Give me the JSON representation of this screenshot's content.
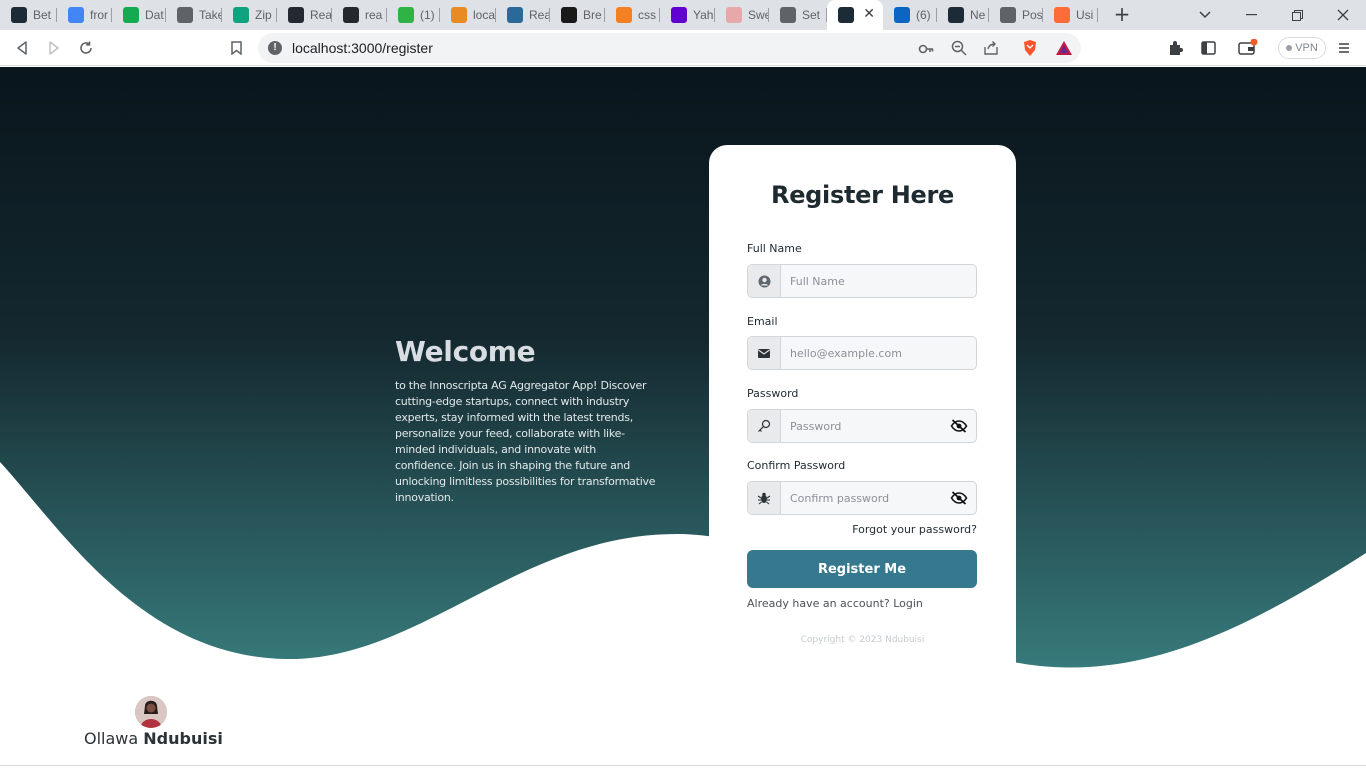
{
  "browser": {
    "tabs": [
      {
        "label": "Bet",
        "icon": "react-icon",
        "color": "#1c2b36"
      },
      {
        "label": "fror",
        "icon": "google-icon",
        "color": "#4285f4"
      },
      {
        "label": "Dat",
        "icon": "mongodb-icon",
        "color": "#13aa52"
      },
      {
        "label": "Take",
        "icon": "globe-icon",
        "color": "#5f6368"
      },
      {
        "label": "Zip",
        "icon": "openai-icon",
        "color": "#10a37f"
      },
      {
        "label": "Rea",
        "icon": "github-icon",
        "color": "#24292f"
      },
      {
        "label": "rea",
        "icon": "github-icon",
        "color": "#24292f"
      },
      {
        "label": "(1) ",
        "icon": "one-icon",
        "color": "#2fb344"
      },
      {
        "label": "loca",
        "icon": "pwa-icon",
        "color": "#e88b24"
      },
      {
        "label": "Rea",
        "icon": "rtk-icon",
        "color": "#2a6a9a"
      },
      {
        "label": "Bre",
        "icon": "st-icon",
        "color": "#1a1a1a"
      },
      {
        "label": "css",
        "icon": "stackoverflow-icon",
        "color": "#f48024"
      },
      {
        "label": "Yah",
        "icon": "yahoo-icon",
        "color": "#6001d2"
      },
      {
        "label": "Swe",
        "icon": "sweet-icon",
        "color": "#e6a8a8"
      },
      {
        "label": "Set",
        "icon": "gear-icon",
        "color": "#5f6368"
      },
      {
        "label": "",
        "icon": "react-icon",
        "color": "#1c2b36"
      },
      {
        "label": "(6)",
        "icon": "linkedin-icon",
        "color": "#0a66c2"
      },
      {
        "label": "Ne",
        "icon": "react-icon",
        "color": "#1c2b36"
      },
      {
        "label": "Pos",
        "icon": "globe-icon",
        "color": "#5f6368"
      },
      {
        "label": "Usi",
        "icon": "swagger-icon",
        "color": "#ff6c37"
      }
    ],
    "active_tab_index": 15,
    "url": "localhost:3000/register",
    "vpn_label": "VPN"
  },
  "hero": {
    "title": "Welcome",
    "text": "to the Innoscripta AG Aggregator App! Discover cutting-edge startups, connect with industry experts, stay informed with the latest trends, personalize your feed, collaborate with like-minded individuals, and innovate with confidence. Join us in shaping the future and unlocking limitless possibilities for transformative innovation."
  },
  "form": {
    "title": "Register Here",
    "full_name_label": "Full Name",
    "full_name_placeholder": "Full Name",
    "email_label": "Email",
    "email_placeholder": "hello@example.com",
    "password_label": "Password",
    "password_placeholder": "Password",
    "confirm_label": "Confirm Password",
    "confirm_placeholder": "Confirm password",
    "forgot": "Forgot your password?",
    "submit": "Register Me",
    "login_link": "Already have an account? Login",
    "copyright": "Copyright © 2023   Ndubuisi"
  },
  "author": {
    "first_name": "Ollawa",
    "last_name": "Ndubuisi"
  },
  "colors": {
    "gradient_top": "#09151c",
    "gradient_mid": "#14282f",
    "gradient_bottom": "#377a7b",
    "button": "#36798f"
  }
}
